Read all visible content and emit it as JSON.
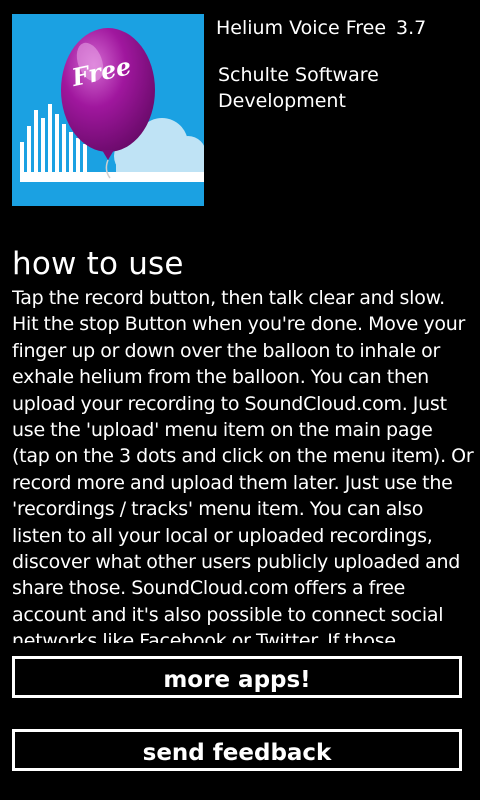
{
  "app": {
    "icon": "helium-balloon-free-icon",
    "icon_badge_text": "Free",
    "name": "Helium Voice Free",
    "version": "3.7",
    "publisher": "Schulte Software Development"
  },
  "section": {
    "heading": "how to use",
    "body": "Tap the record button, then talk clear and slow. Hit the stop Button when you're done. Move your finger up or down over the balloon to inhale or exhale helium from the balloon. You can then upload your recording to SoundCloud.com. Just use the 'upload' menu item on the main page (tap on the 3 dots and click on the menu item). Or record more and upload them later. Just use the 'recordings / tracks' menu item. You can also listen to all your local or uploaded recordings, discover what other users publicly uploaded and share those. SoundCloud.com offers a free account and it's also possible to connect social networks like Facebook or Twitter. If those networks are"
  },
  "buttons": {
    "more_apps": "more apps!",
    "send_feedback": "send feedback"
  },
  "colors": {
    "background": "#000000",
    "icon_background": "#1ba1e2",
    "balloon": "#a0179e",
    "text": "#ffffff"
  }
}
